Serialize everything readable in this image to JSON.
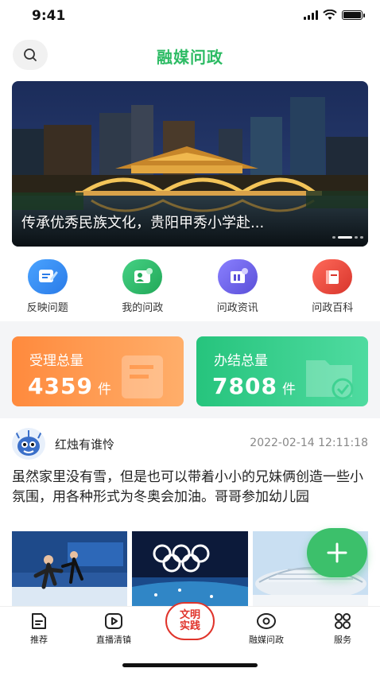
{
  "status_bar": {
    "time": "9:41"
  },
  "header": {
    "title": "融媒问政",
    "search_icon": "search-icon"
  },
  "banner": {
    "caption": "传承优秀民族文化，贵阳甲秀小学赴...",
    "slide_count": 4,
    "active_index": 1
  },
  "quick_nav": [
    {
      "label": "反映问题",
      "icon": "edit-report-icon",
      "color": "#3b8ef5"
    },
    {
      "label": "我的问政",
      "icon": "user-card-icon",
      "color": "#2fbf6a"
    },
    {
      "label": "问政资讯",
      "icon": "news-building-icon",
      "color": "#6c63e8"
    },
    {
      "label": "问政百科",
      "icon": "book-icon",
      "color": "#e8453c"
    }
  ],
  "stats": {
    "accepted": {
      "label": "受理总量",
      "value": "4359",
      "unit": "件",
      "color": "#ff8a3d"
    },
    "completed": {
      "label": "办结总量",
      "value": "7808",
      "unit": "件",
      "color": "#26c47d"
    }
  },
  "post": {
    "username": "红烛有谁怜",
    "time": "2022-02-14 12:11:18",
    "body": "虽然家里没有雪，但是也可以带着小小的兄妹俩创造一些小氛围，用各种形式为冬奥会加油。哥哥参加幼儿园",
    "images": [
      "figure-skating-photo",
      "olympic-rings-photo",
      "stadium-photo"
    ]
  },
  "fab": {
    "icon": "plus-icon"
  },
  "tabbar": {
    "items": [
      {
        "label": "推荐",
        "icon": "document-icon"
      },
      {
        "label": "直播清镇",
        "icon": "play-icon"
      },
      {
        "label": "融媒问政",
        "icon": "eye-icon"
      },
      {
        "label": "服务",
        "icon": "grid-icon"
      }
    ],
    "center": {
      "label": "文明实践"
    }
  }
}
